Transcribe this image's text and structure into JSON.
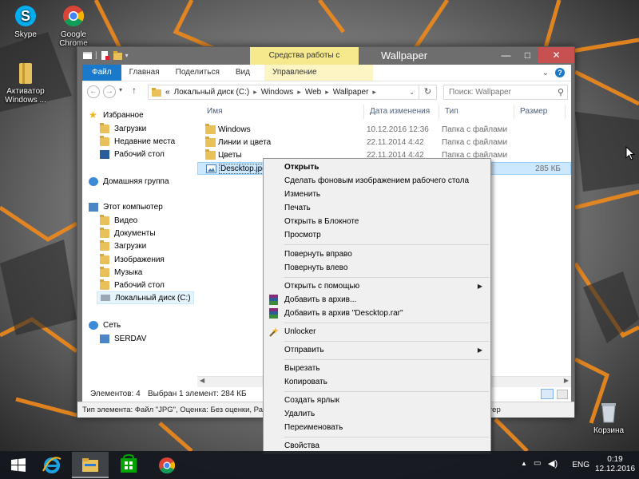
{
  "desktop": {
    "icons": [
      {
        "label": "Skype"
      },
      {
        "label": "Google Chrome"
      },
      {
        "label": "Активатор Windows ..."
      },
      {
        "label": "Корзина"
      }
    ]
  },
  "window": {
    "title": "Wallpaper",
    "context_tab_header": "Средства работы с рисунками",
    "ribbon_tabs": [
      "Файл",
      "Главная",
      "Поделиться",
      "Вид",
      "Управление"
    ],
    "address": {
      "crumbs": [
        "«",
        "Локальный диск (C:)",
        "Windows",
        "Web",
        "Wallpaper"
      ]
    },
    "search_placeholder": "Поиск: Wallpaper",
    "nav_pane": {
      "favorites": "Избранное",
      "favorites_items": [
        "Загрузки",
        "Недавние места",
        "Рабочий стол"
      ],
      "homegroup": "Домашняя группа",
      "this_pc": "Этот компьютер",
      "this_pc_items": [
        "Видео",
        "Документы",
        "Загрузки",
        "Изображения",
        "Музыка",
        "Рабочий стол",
        "Локальный диск (C:)"
      ],
      "network": "Сеть",
      "network_items": [
        "SERDAV"
      ]
    },
    "columns": [
      "Имя",
      "Дата изменения",
      "Тип",
      "Размер"
    ],
    "files": [
      {
        "name": "Windows",
        "date": "10.12.2016 12:36",
        "type": "Папка с файлами",
        "size": ""
      },
      {
        "name": "Линии и цвета",
        "date": "22.11.2014 4:42",
        "type": "Папка с файлами",
        "size": ""
      },
      {
        "name": "Цветы",
        "date": "22.11.2014 4:42",
        "type": "Папка с файлами",
        "size": ""
      },
      {
        "name": "Desсktop.jpg",
        "date": "",
        "type": "",
        "size": "285 КБ"
      }
    ],
    "status": {
      "items_count": "Элементов: 4",
      "selected": "Выбран 1 элемент: 284 КБ"
    },
    "info_bar_left": "Тип элемента: Файл \"JPG\", Оценка: Без оценки, Разм",
    "info_bar_right": "ютер"
  },
  "context_menu": {
    "items": [
      "Открыть",
      "Сделать фоновым изображением рабочего стола",
      "Изменить",
      "Печать",
      "Открыть в Блокноте",
      "Просмотр",
      "Повернуть вправо",
      "Повернуть влево",
      "Открыть с помощью",
      "Добавить в архив...",
      "Добавить в архив \"Desсktop.rar\"",
      "Unlocker",
      "Отправить",
      "Вырезать",
      "Копировать",
      "Создать ярлык",
      "Удалить",
      "Переименовать",
      "Свойства"
    ]
  },
  "taskbar": {
    "lang": "ENG",
    "time": "0:19",
    "date": "12.12.2016"
  },
  "colors": {
    "accent": "#1979ca",
    "context_tab": "#f6e88d",
    "selection": "#cce8ff",
    "wallpaper_orange": "#f08a1c"
  }
}
